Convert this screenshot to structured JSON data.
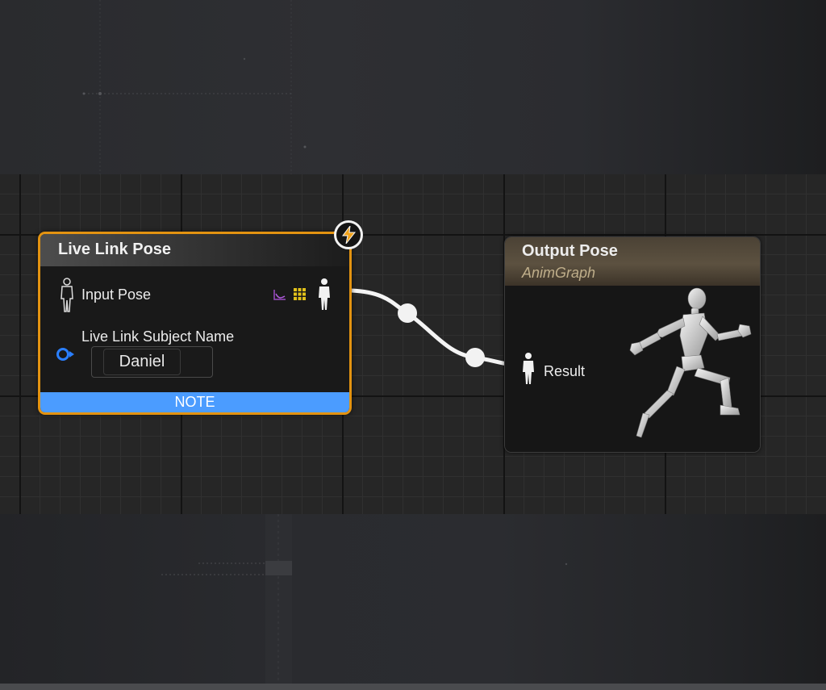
{
  "canvas": {
    "background_color": "#262626",
    "accent_color": "#e39311",
    "note_color": "#4b9cff"
  },
  "live_link_node": {
    "title": "Live Link Pose",
    "input_pose_label": "Input Pose",
    "subject_name_label": "Live Link Subject Name",
    "subject_name_value": "Daniel",
    "note_label": "NOTE",
    "icons": [
      "mannequin-pin-icon",
      "curve-icon",
      "grid-icon",
      "mannequin-output-pin-icon",
      "lightning-icon",
      "object-pin-icon"
    ]
  },
  "output_node": {
    "title": "Output Pose",
    "subtitle": "AnimGraph",
    "result_label": "Result",
    "icons": [
      "mannequin-pin-icon",
      "running-mannequin-icon"
    ]
  }
}
